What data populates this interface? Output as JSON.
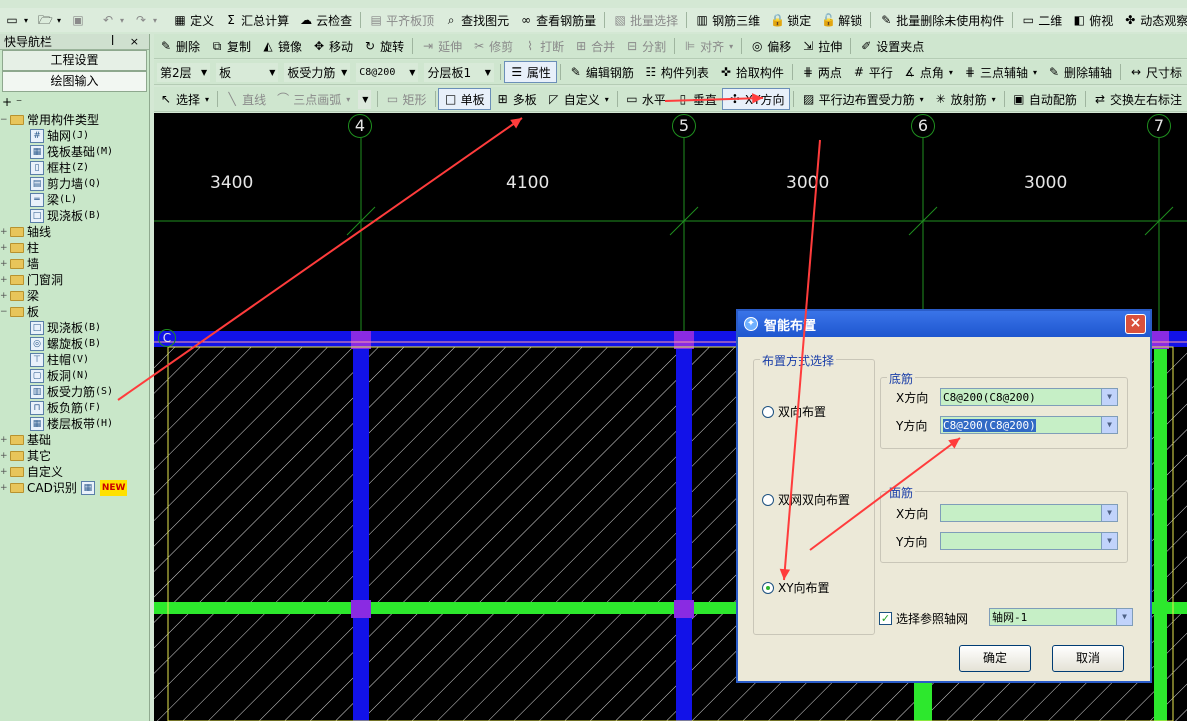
{
  "menu_row": {
    "items": [
      {
        "icon": "table-icon",
        "label": "定义"
      },
      {
        "icon": "sigma-icon",
        "label": "汇总计算"
      },
      {
        "icon": "cloud-check-icon",
        "label": "云检查"
      },
      {
        "icon": "slab-top-icon",
        "label": "平齐板顶",
        "disabled": true
      },
      {
        "icon": "find-icon",
        "label": "查找图元"
      },
      {
        "icon": "glasses-icon",
        "label": "查看钢筋量"
      },
      {
        "icon": "batch-icon",
        "label": "批量选择",
        "disabled": true
      },
      {
        "icon": "rebar-3d-icon",
        "label": "钢筋三维"
      },
      {
        "icon": "lock-icon",
        "label": "锁定"
      },
      {
        "icon": "unlock-icon",
        "label": "解锁"
      },
      {
        "icon": "batch-delete-icon",
        "label": "批量删除未使用构件"
      },
      {
        "icon": "view-2d-icon",
        "label": "二维"
      },
      {
        "icon": "top-view-icon",
        "label": "俯视"
      },
      {
        "icon": "orbit-icon",
        "label": "动态观察"
      }
    ]
  },
  "panel": {
    "title": "快导航栏",
    "controls": "ꟾ ×",
    "buttons": [
      "工程设置",
      "绘图输入"
    ],
    "tree_toolbar": "+ ⁻",
    "tree": [
      {
        "level": 0,
        "type": "folder",
        "toggle": "−",
        "label": "常用构件类型"
      },
      {
        "level": 1,
        "type": "leaf",
        "icon": "grid-icon",
        "label": "轴网",
        "key": "(J)"
      },
      {
        "level": 1,
        "type": "leaf",
        "icon": "raft-icon",
        "label": "筏板基础",
        "key": "(M)"
      },
      {
        "level": 1,
        "type": "leaf",
        "icon": "column-icon",
        "label": "框柱",
        "key": "(Z)"
      },
      {
        "level": 1,
        "type": "leaf",
        "icon": "shear-wall-icon",
        "label": "剪力墙",
        "key": "(Q)"
      },
      {
        "level": 1,
        "type": "leaf",
        "icon": "beam-icon",
        "label": "梁",
        "key": "(L)"
      },
      {
        "level": 1,
        "type": "leaf",
        "icon": "slab-icon",
        "label": "现浇板",
        "key": "(B)"
      },
      {
        "level": 0,
        "type": "folder",
        "toggle": "+",
        "label": "轴线"
      },
      {
        "level": 0,
        "type": "folder",
        "toggle": "+",
        "label": "柱"
      },
      {
        "level": 0,
        "type": "folder",
        "toggle": "+",
        "label": "墙"
      },
      {
        "level": 0,
        "type": "folder",
        "toggle": "+",
        "label": "门窗洞"
      },
      {
        "level": 0,
        "type": "folder",
        "toggle": "+",
        "label": "梁"
      },
      {
        "level": 0,
        "type": "folder",
        "toggle": "−",
        "label": "板"
      },
      {
        "level": 1,
        "type": "leaf",
        "icon": "slab-icon",
        "label": "现浇板",
        "key": "(B)"
      },
      {
        "level": 1,
        "type": "leaf",
        "icon": "spiral-slab-icon",
        "label": "螺旋板",
        "key": "(B)"
      },
      {
        "level": 1,
        "type": "leaf",
        "icon": "column-cap-icon",
        "label": "柱帽",
        "key": "(V)"
      },
      {
        "level": 1,
        "type": "leaf",
        "icon": "slab-hole-icon",
        "label": "板洞",
        "key": "(N)"
      },
      {
        "level": 1,
        "type": "leaf",
        "icon": "slab-rebar-icon",
        "label": "板受力筋",
        "key": "(S)"
      },
      {
        "level": 1,
        "type": "leaf",
        "icon": "neg-rebar-icon",
        "label": "板负筋",
        "key": "(F)"
      },
      {
        "level": 1,
        "type": "leaf",
        "icon": "floor-band-icon",
        "label": "楼层板带",
        "key": "(H)"
      },
      {
        "level": 0,
        "type": "folder",
        "toggle": "+",
        "label": "基础"
      },
      {
        "level": 0,
        "type": "folder",
        "toggle": "+",
        "label": "其它"
      },
      {
        "level": 0,
        "type": "folder",
        "toggle": "+",
        "label": "自定义"
      },
      {
        "level": 0,
        "type": "folder",
        "toggle": "+",
        "label": "CAD识别",
        "badge": "NEW"
      }
    ]
  },
  "toolbar2": {
    "items": [
      {
        "icon": "delete-icon",
        "label": "删除"
      },
      {
        "icon": "copy-icon",
        "label": "复制"
      },
      {
        "icon": "mirror-icon",
        "label": "镜像"
      },
      {
        "icon": "move-icon",
        "label": "移动"
      },
      {
        "icon": "rotate-icon",
        "label": "旋转"
      },
      {
        "icon": "extend-icon",
        "label": "延伸",
        "disabled": true
      },
      {
        "icon": "trim-icon",
        "label": "修剪",
        "disabled": true
      },
      {
        "icon": "break-icon",
        "label": "打断",
        "disabled": true
      },
      {
        "icon": "merge-icon",
        "label": "合并",
        "disabled": true
      },
      {
        "icon": "split-icon",
        "label": "分割",
        "disabled": true
      },
      {
        "icon": "align-icon",
        "label": "对齐",
        "disabled": true,
        "dropdown": true
      },
      {
        "icon": "offset-icon",
        "label": "偏移"
      },
      {
        "icon": "stretch-icon",
        "label": "拉伸"
      },
      {
        "icon": "grip-icon",
        "label": "设置夹点"
      }
    ]
  },
  "toolbar3": {
    "floor": "第2层",
    "category": "板",
    "component_type": "板受力筋",
    "spec": "C8@200",
    "layer": "分层板1",
    "items": [
      {
        "icon": "properties-icon",
        "label": "属性",
        "active": true
      },
      {
        "icon": "edit-rebar-icon",
        "label": "编辑钢筋"
      },
      {
        "icon": "list-icon",
        "label": "构件列表"
      },
      {
        "icon": "pick-icon",
        "label": "拾取构件"
      },
      {
        "icon": "two-point-icon",
        "label": "两点"
      },
      {
        "icon": "parallel-icon",
        "label": "平行"
      },
      {
        "icon": "point-angle-icon",
        "label": "点角",
        "dropdown": true
      },
      {
        "icon": "three-point-icon",
        "label": "三点辅轴",
        "dropdown": true
      },
      {
        "icon": "delete-aux-icon",
        "label": "删除辅轴"
      },
      {
        "icon": "dimension-icon",
        "label": "尺寸标"
      }
    ]
  },
  "toolbar4": {
    "items": [
      {
        "icon": "cursor-icon",
        "label": "选择",
        "dropdown": true
      },
      {
        "icon": "line-icon",
        "label": "直线",
        "disabled": true
      },
      {
        "icon": "arc-icon",
        "label": "三点画弧",
        "disabled": true,
        "dropdown": true
      },
      {
        "type": "combo"
      },
      {
        "icon": "rect-icon",
        "label": "矩形",
        "disabled": true
      },
      {
        "icon": "single-slab-icon",
        "label": "单板",
        "active": true
      },
      {
        "icon": "multi-slab-icon",
        "label": "多板"
      },
      {
        "icon": "custom-icon",
        "label": "自定义",
        "dropdown": true
      },
      {
        "icon": "horizontal-icon",
        "label": "水平"
      },
      {
        "icon": "vertical-icon",
        "label": "垂直"
      },
      {
        "icon": "xy-dir-icon",
        "label": "XY方向",
        "active": true
      },
      {
        "icon": "parallel-edge-icon",
        "label": "平行边布置受力筋",
        "dropdown": true
      },
      {
        "icon": "radial-icon",
        "label": "放射筋",
        "dropdown": true
      },
      {
        "icon": "auto-rebar-icon",
        "label": "自动配筋"
      },
      {
        "icon": "swap-label-icon",
        "label": "交换左右标注"
      }
    ]
  },
  "canvas": {
    "axes": [
      "4",
      "5",
      "6",
      "7"
    ],
    "row_axis": "C",
    "dims": [
      "3400",
      "4100",
      "3000",
      "3000"
    ]
  },
  "dialog": {
    "title": "智能布置",
    "close": "×",
    "group_mode": "布置方式选择",
    "modes": [
      {
        "label": "双向布置",
        "checked": false
      },
      {
        "label": "双网双向布置",
        "checked": false
      },
      {
        "label": "XY向布置",
        "checked": true
      }
    ],
    "bottom_group": "底筋",
    "top_group": "面筋",
    "x_label": "X方向",
    "y_label": "Y方向",
    "bottom_x": "C8@200(C8@200)",
    "bottom_y": "C8@200(C8@200)",
    "top_x": "",
    "top_y": "",
    "ref_axis_label": "选择参照轴网",
    "ref_axis_checked": true,
    "ref_axis_value": "轴网-1",
    "ok": "确定",
    "cancel": "取消"
  },
  "colors": {
    "canvas_bg": "#000000",
    "beam_blue": "#1212e8",
    "beam_green": "#2de82d",
    "grid_green": "#1f8f1f",
    "arrow_red": "#ff3c3c"
  }
}
